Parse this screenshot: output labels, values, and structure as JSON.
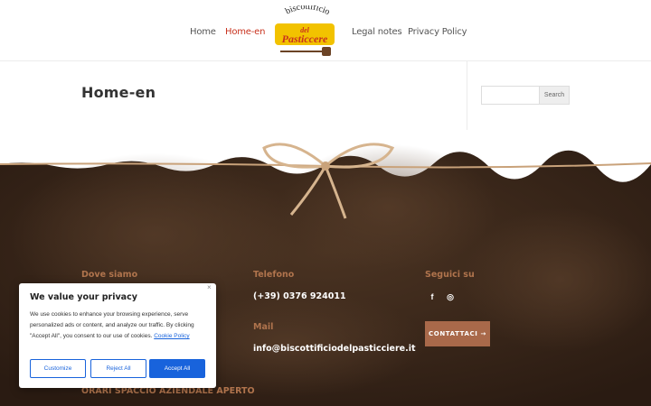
{
  "nav": {
    "home": "Home",
    "home_en": "Home-en",
    "legal": "Legal notes",
    "privacy": "Privacy Policy"
  },
  "logo": {
    "top": "biscottificio",
    "main": "del Pasticcere"
  },
  "page": {
    "title": "Home-en"
  },
  "search": {
    "placeholder": "",
    "button": "Search"
  },
  "footer": {
    "dove_heading": "Dove siamo",
    "orari_heading": "ORARI SPACCIO AZIENDALE APERTO",
    "telefono_heading": "Telefono",
    "telefono_value": "(+39) 0376 924011",
    "mail_heading": "Mail",
    "mail_value": "info@biscottificiodelpasticciere.it",
    "seguici_heading": "Seguici su",
    "facebook_icon": "f",
    "instagram_icon": "◎",
    "contact_button": "CONTATTACI →"
  },
  "cookie": {
    "title": "We value your privacy",
    "close": "×",
    "body": "We use cookies to enhance your browsing experience, serve personalized ads or content, and analyze our traffic. By clicking \"Accept All\", you consent to our use of cookies.",
    "link": "Cookie Policy",
    "customize": "Customize",
    "reject": "Reject All",
    "accept": "Accept All"
  },
  "colors": {
    "accent_red": "#c8321e",
    "footer_heading": "#b0744d",
    "cookie_blue": "#1863dc",
    "contact_button": "#a9694a",
    "footer_bg": "#3b281b"
  }
}
